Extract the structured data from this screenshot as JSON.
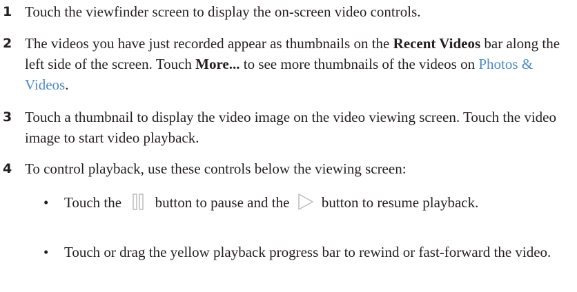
{
  "steps": [
    {
      "number": "1",
      "text": "Touch the viewfinder screen to display the on-screen video controls."
    },
    {
      "number": "2",
      "text_a": "The videos you have just recorded appear as thumbnails on the ",
      "bold_a": "Recent Videos",
      "text_b": " bar along the left side of the screen. Touch ",
      "bold_b": "More...",
      "text_c": " to see more thumbnails of the videos on ",
      "link": "Photos & Videos",
      "text_d": "."
    },
    {
      "number": "3",
      "text": "Touch a thumbnail to display the video image on the video viewing screen. Touch the video image to start video playback."
    },
    {
      "number": "4",
      "text": "To control playback, use these controls below the viewing screen:"
    }
  ],
  "bullets": [
    {
      "marker": "•",
      "text_a": "Touch the ",
      "icon_a": "pause-icon",
      "text_b": " button to pause and the ",
      "icon_b": "play-icon",
      "text_c": " button to resume playback."
    },
    {
      "marker": "•",
      "text": "Touch or drag the yellow playback progress bar to rewind or fast-forward the video."
    }
  ],
  "colors": {
    "text": "#231f20",
    "link": "#4e8ac8",
    "icon_stroke": "#bcbcbc"
  }
}
